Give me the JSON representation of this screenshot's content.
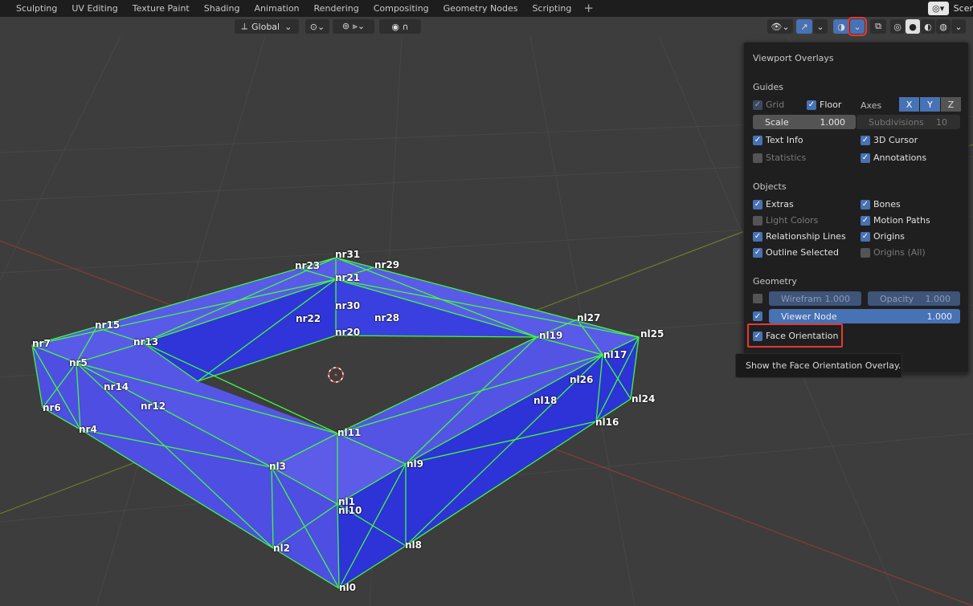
{
  "workspace_tabs": [
    "Sculpting",
    "UV Editing",
    "Texture Paint",
    "Shading",
    "Animation",
    "Rendering",
    "Compositing",
    "Geometry Nodes",
    "Scripting"
  ],
  "add_tab": "+",
  "scene_label": "Scer",
  "header": {
    "transform_orientation": "Global",
    "icons": [
      "transform-pivot-icon",
      "snapping-icon",
      "proportional-edit-icon",
      "visibility-icon",
      "gizmo-icon",
      "overlay-icon",
      "xray-icon",
      "shading-wireframe-icon",
      "shading-solid-icon",
      "shading-material-icon",
      "shading-rendered-icon"
    ]
  },
  "vertex_labels": [
    "nr31",
    "nr23",
    "nr29",
    "nr21",
    "nr30",
    "nr22",
    "nr28",
    "nr20",
    "nr15",
    "nr7",
    "nr13",
    "nr5",
    "nr14",
    "nr12",
    "nr6",
    "nr4",
    "nl27",
    "nl25",
    "nl19",
    "nl17",
    "nl26",
    "nl24",
    "nl18",
    "nl16",
    "nl11",
    "nl9",
    "nl3",
    "nl1",
    "nl10",
    "nl2",
    "nl8",
    "nl0"
  ],
  "overlay_panel": {
    "title": "Viewport Overlays",
    "guides": {
      "section": "Guides",
      "grid": "Grid",
      "floor": "Floor",
      "axes_label": "Axes",
      "axes": [
        "X",
        "Y",
        "Z"
      ],
      "scale_label": "Scale",
      "scale_value": "1.000",
      "subdivisions_label": "Subdivisions",
      "subdivisions_value": "10",
      "text_info": "Text Info",
      "cursor_3d": "3D Cursor",
      "statistics": "Statistics",
      "annotations": "Annotations"
    },
    "objects": {
      "section": "Objects",
      "extras": "Extras",
      "bones": "Bones",
      "light_colors": "Light Colors",
      "motion_paths": "Motion Paths",
      "relationship_lines": "Relationship Lines",
      "origins": "Origins",
      "outline_selected": "Outline Selected",
      "origins_all": "Origins (All)"
    },
    "geometry": {
      "section": "Geometry",
      "wireframe_label": "Wirefram",
      "wireframe_value": "1.000",
      "opacity_label": "Opacity",
      "opacity_value": "1.000",
      "viewer_node_label": "Viewer Node",
      "viewer_node_value": "1.000",
      "face_orientation": "Face Orientation"
    }
  },
  "tooltip": "Show the Face Orientation Overlay.",
  "check_mark": "✓"
}
